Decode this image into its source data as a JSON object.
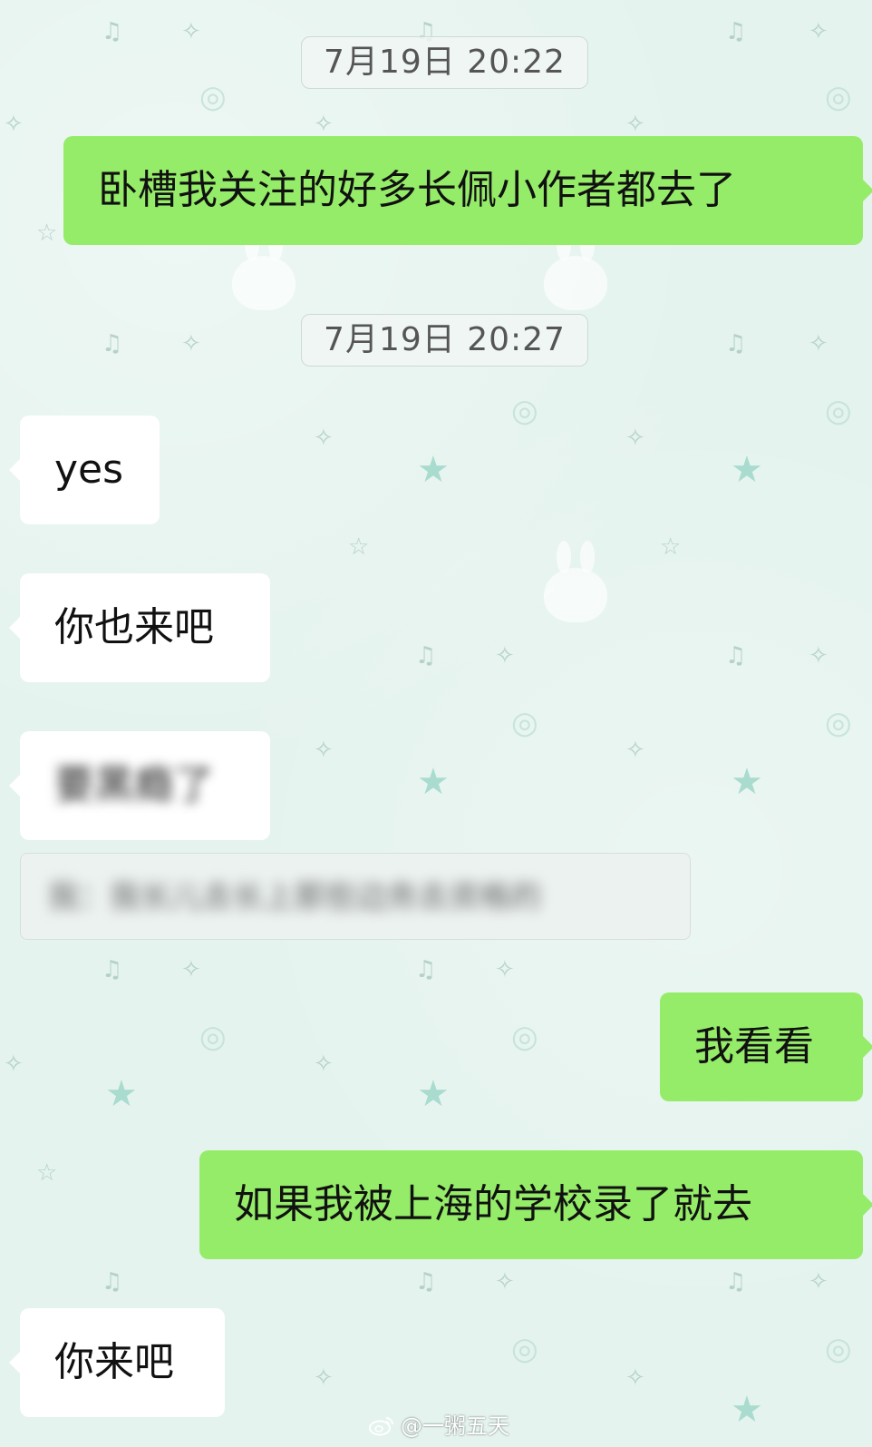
{
  "messages": [
    {
      "type": "timestamp",
      "text": "7月19日 20:22"
    },
    {
      "type": "sent",
      "text": "卧槽我关注的好多长佩小作者都去了"
    },
    {
      "type": "timestamp",
      "text": "7月19日 20:27"
    },
    {
      "type": "received",
      "text": "yes"
    },
    {
      "type": "received",
      "text": "你也来吧"
    },
    {
      "type": "received",
      "text": "要黑瘾了",
      "blurred": true
    },
    {
      "type": "quote",
      "text": "我：我长儿去长上那些边务去资格的",
      "blurred": true
    },
    {
      "type": "sent",
      "text": "我看看"
    },
    {
      "type": "sent",
      "text": "如果我被上海的学校录了就去"
    },
    {
      "type": "received",
      "text": "你来吧"
    }
  ],
  "watermark": {
    "icon": "weibo-icon",
    "text": "@一粥五天"
  },
  "colors": {
    "sent_bubble": "#95ec69",
    "received_bubble": "#ffffff",
    "background": "#e4f3ee"
  }
}
